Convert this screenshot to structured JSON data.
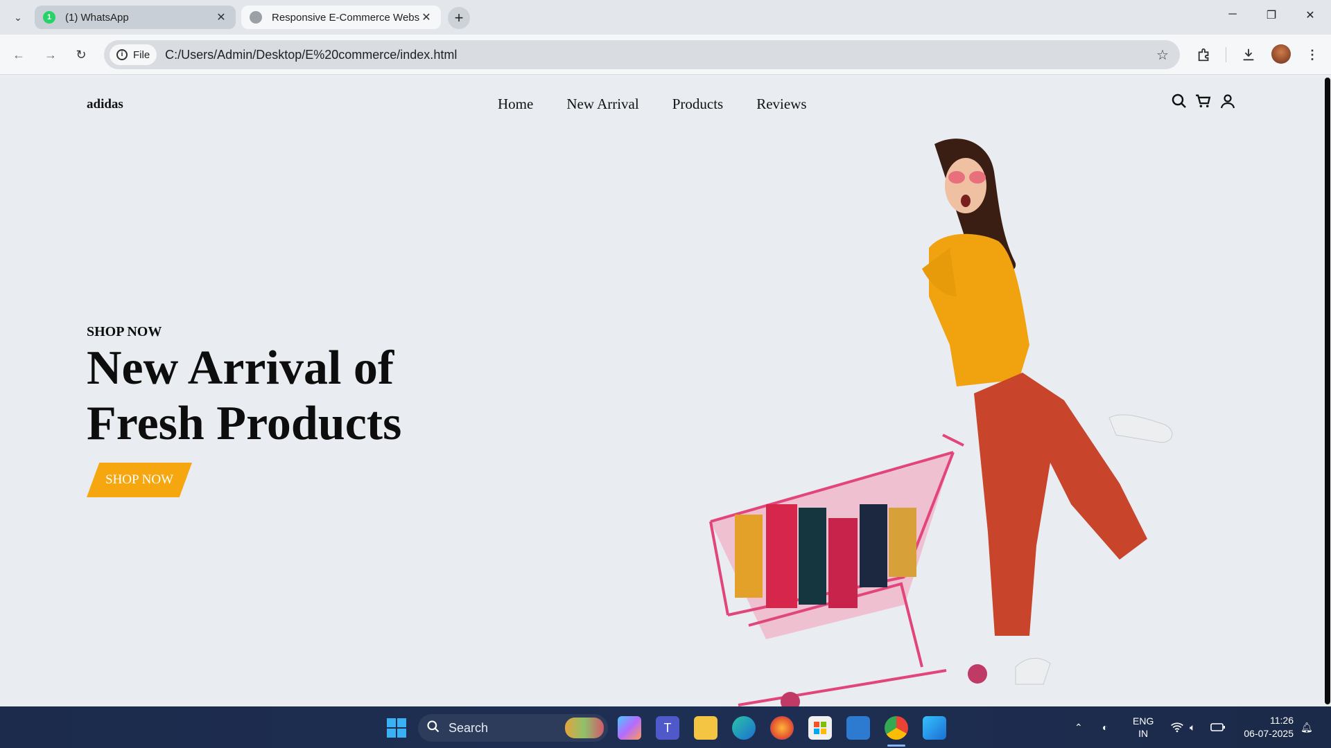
{
  "browser": {
    "tabs": [
      {
        "title": "(1) WhatsApp",
        "active": false
      },
      {
        "title": "Responsive E-Commerce Websi",
        "active": true
      }
    ],
    "file_label": "File",
    "url": "C:/Users/Admin/Desktop/E%20commerce/index.html"
  },
  "site": {
    "logo": "adidas",
    "nav": [
      "Home",
      "New Arrival",
      "Products",
      "Reviews"
    ],
    "hero": {
      "eyebrow": "SHOP NOW",
      "headline_line1": "New Arrival of",
      "headline_line2": "Fresh Products",
      "cta": "SHOP NOW"
    },
    "accent_color": "#f6a70f"
  },
  "taskbar": {
    "search_placeholder": "Search",
    "lang_top": "ENG",
    "lang_bottom": "IN",
    "time": "11:26",
    "date": "06-07-2025"
  }
}
